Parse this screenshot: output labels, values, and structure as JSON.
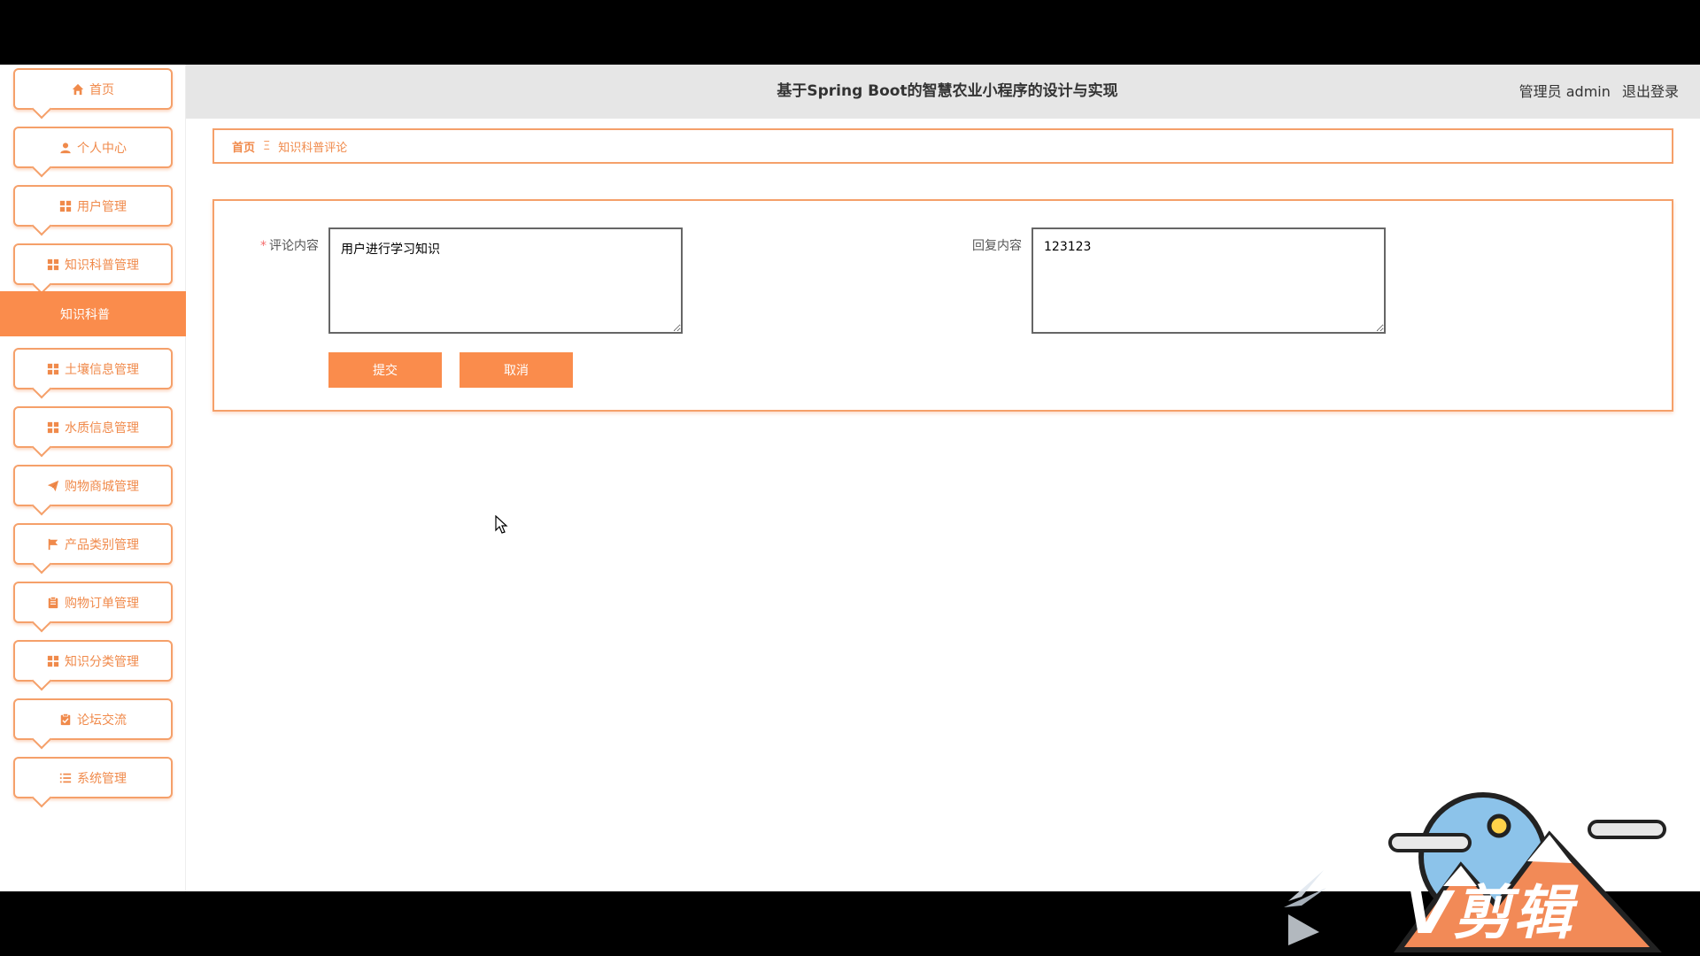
{
  "header": {
    "title": "基于Spring Boot的智慧农业小程序的设计与实现",
    "user_role": "管理员 admin",
    "logout_label": "退出登录"
  },
  "sidebar": {
    "items": [
      {
        "label": "首页",
        "icon": "home-icon"
      },
      {
        "label": "个人中心",
        "icon": "user-icon"
      },
      {
        "label": "用户管理",
        "icon": "grid-icon"
      },
      {
        "label": "知识科普管理",
        "icon": "grid-icon"
      },
      {
        "label": "知识科普",
        "icon": ""
      },
      {
        "label": "土壤信息管理",
        "icon": "grid-icon"
      },
      {
        "label": "水质信息管理",
        "icon": "grid-icon"
      },
      {
        "label": "购物商城管理",
        "icon": "paper-plane-icon"
      },
      {
        "label": "产品类别管理",
        "icon": "flag-icon"
      },
      {
        "label": "购物订单管理",
        "icon": "clipboard-icon"
      },
      {
        "label": "知识分类管理",
        "icon": "grid-icon"
      },
      {
        "label": "论坛交流",
        "icon": "clipboard-check-icon"
      },
      {
        "label": "系统管理",
        "icon": "list-icon"
      }
    ]
  },
  "breadcrumb": {
    "home": "首页",
    "separator": "Ξ",
    "current": "知识科普评论"
  },
  "form": {
    "comment_label": "评论内容",
    "comment_required_mark": "*",
    "comment_value": "用户进行学习知识",
    "reply_label": "回复内容",
    "reply_value": "123123",
    "submit_label": "提交",
    "cancel_label": "取消"
  },
  "watermark": {
    "text": "V剪辑"
  },
  "colors": {
    "accent": "#fa8c4c",
    "border": "#f5a06a",
    "header_bg": "#e6e6e6"
  }
}
